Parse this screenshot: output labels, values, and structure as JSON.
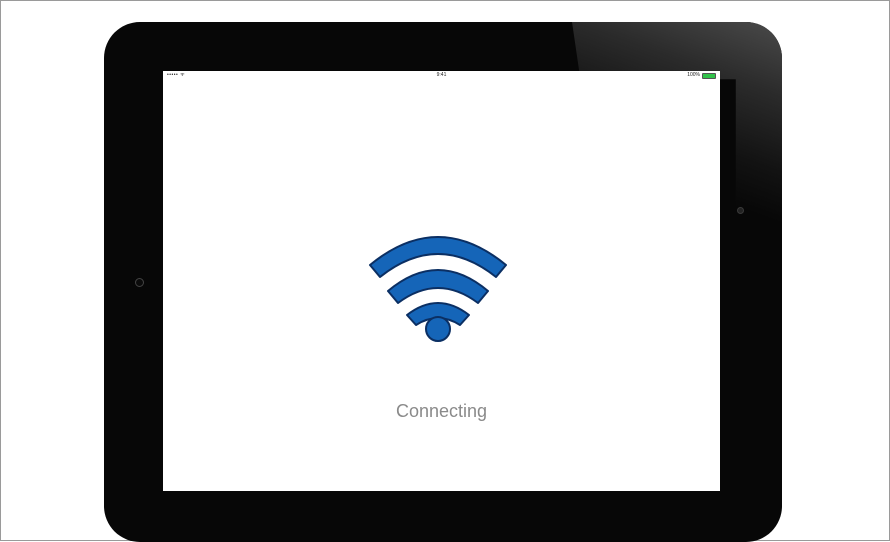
{
  "status_bar": {
    "carrier": "••••• ᯤ",
    "time": "9:41",
    "battery_text": "100%",
    "battery_level": 1.0
  },
  "main": {
    "message": "Connecting",
    "icon": "wifi-icon"
  },
  "colors": {
    "wifi_blue": "#1565b8",
    "wifi_stroke": "#0b2f63",
    "bezel": "#070707",
    "battery_green": "#31c24a",
    "message_gray": "#8a8a8a"
  }
}
